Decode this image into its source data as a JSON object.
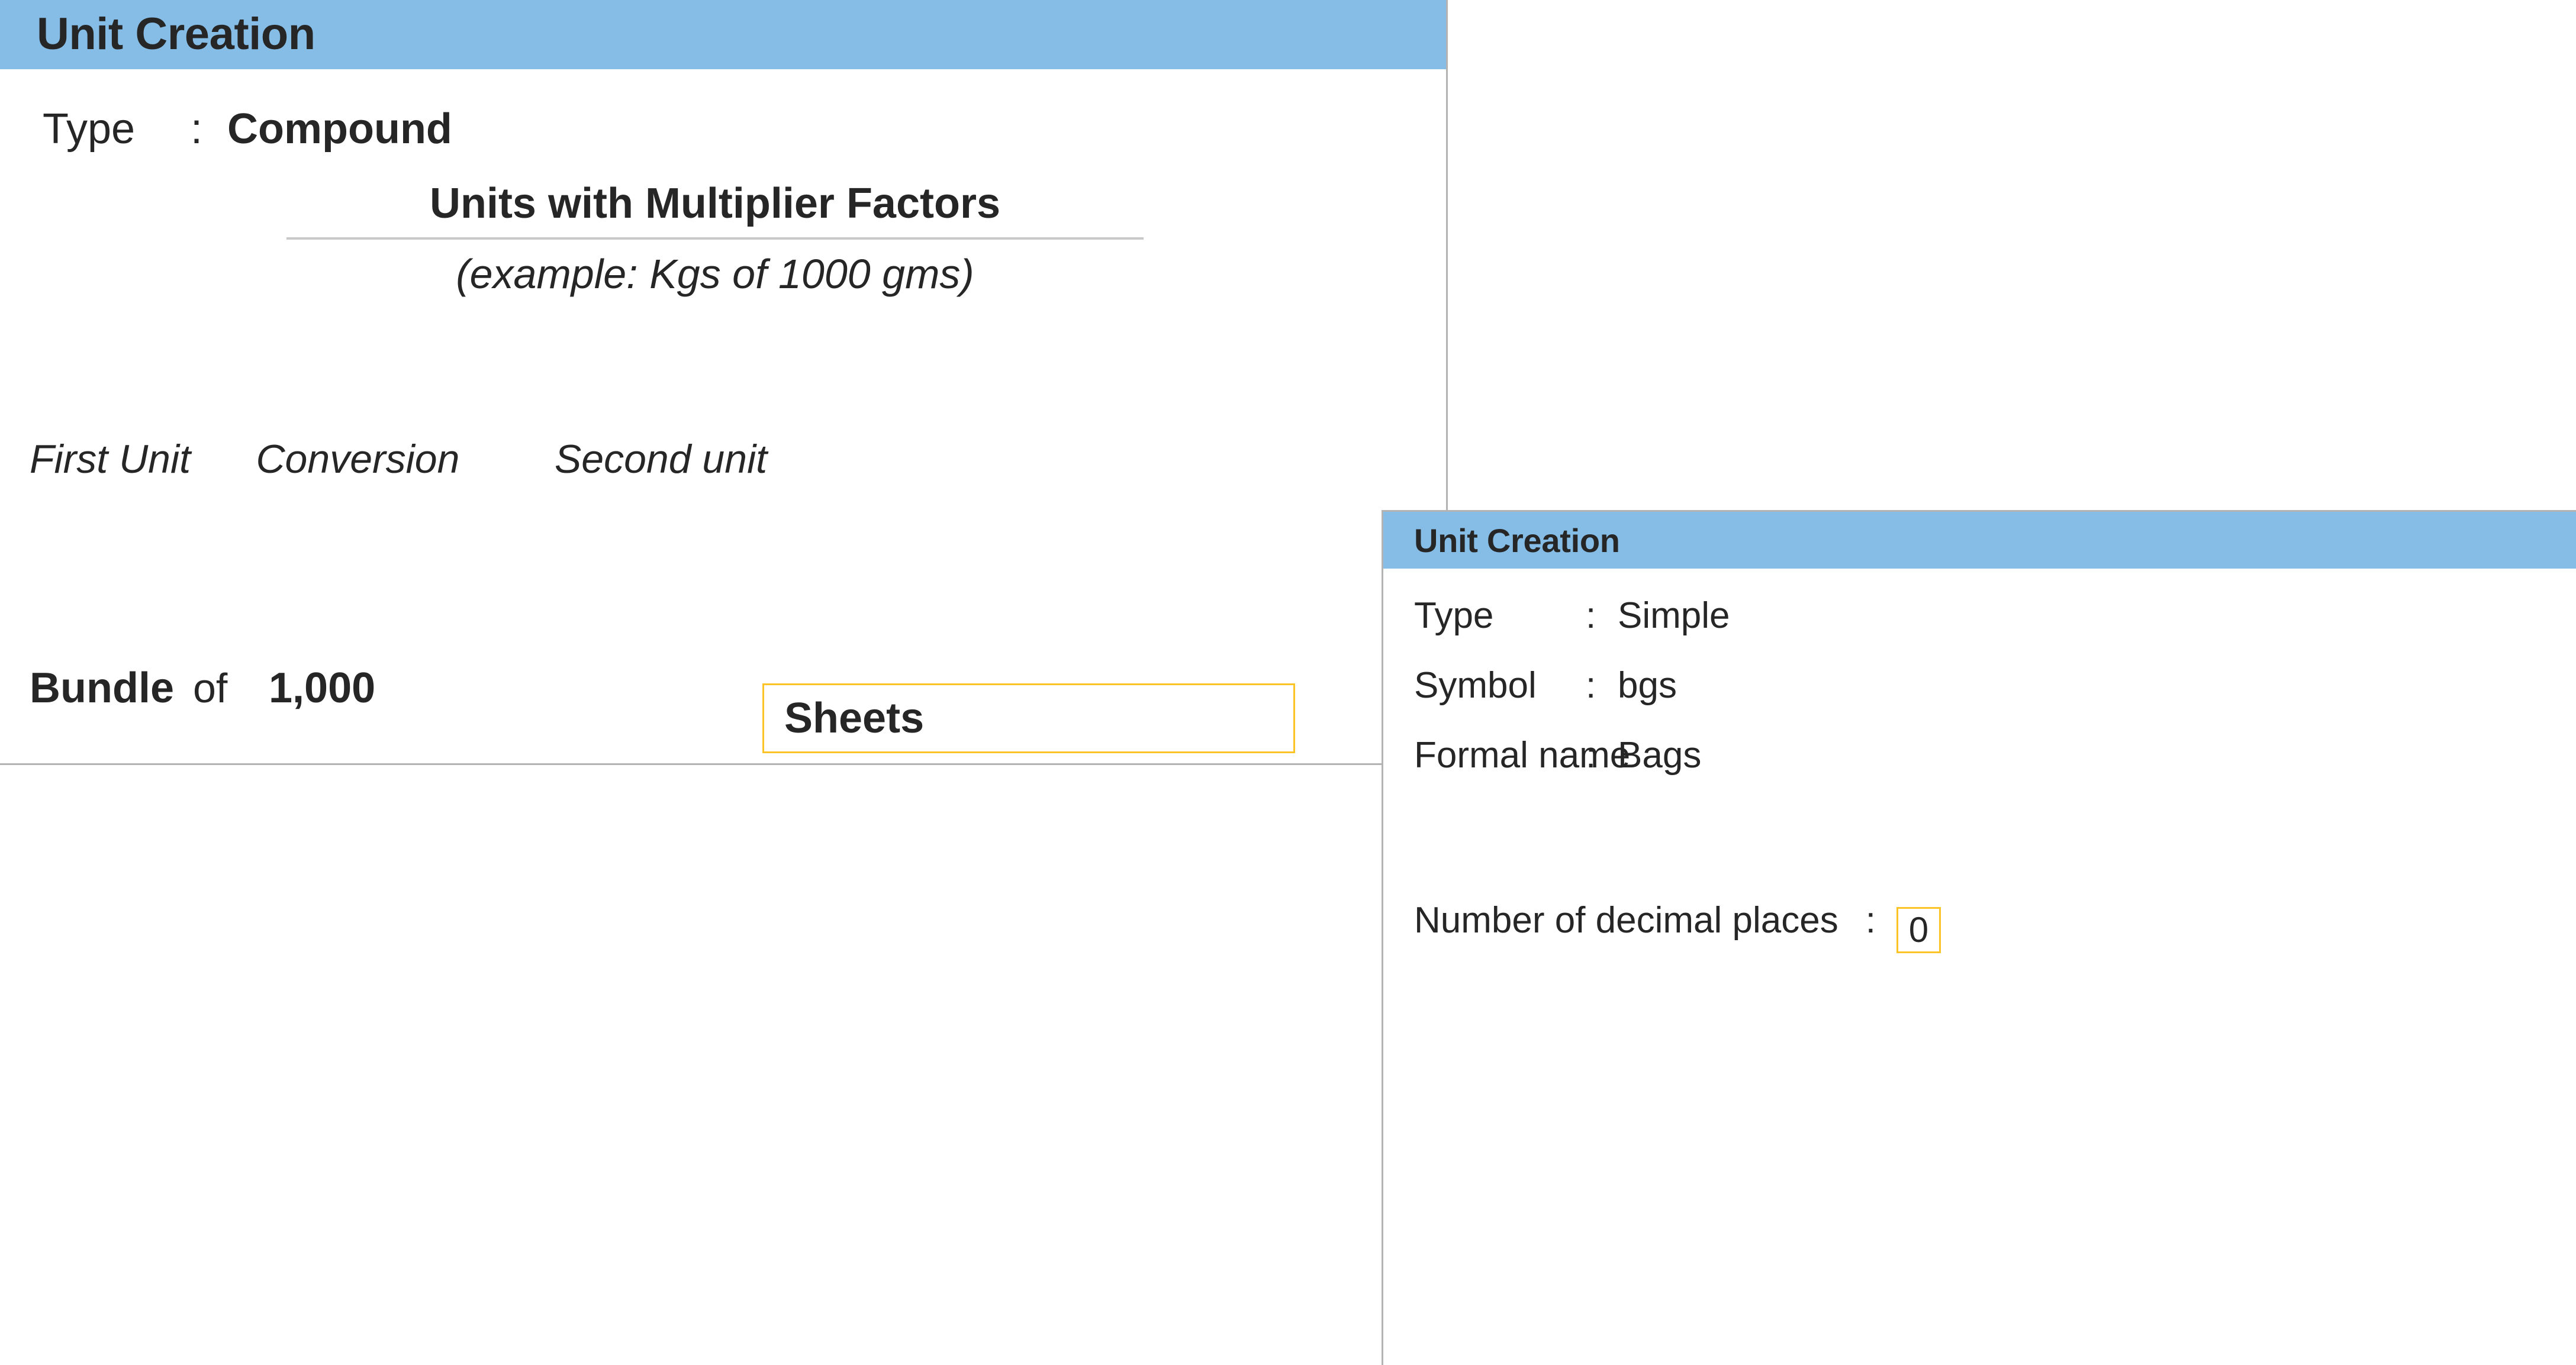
{
  "compound_dialog": {
    "title": "Unit Creation",
    "type_row": {
      "label": "Type",
      "colon": ":",
      "value": "Compound"
    },
    "section": {
      "heading": "Units with Multiplier Factors",
      "example": "(example: Kgs of 1000 gms)"
    },
    "column_headers": {
      "first_unit": "First Unit",
      "conversion": "Conversion",
      "second_unit": "Second unit"
    },
    "data_row": {
      "first_unit": "Bundle",
      "of": "of",
      "quantity": "1,000",
      "second_unit_value": "Sheets"
    }
  },
  "simple_dialog": {
    "title": "Unit Creation",
    "rows": [
      {
        "label": "Type",
        "colon": ":",
        "value": "Simple"
      },
      {
        "label": "Symbol",
        "colon": ":",
        "value": "bgs"
      },
      {
        "label": "Formal name",
        "colon": ":",
        "value": "Bags"
      }
    ],
    "decimals_row": {
      "label": "Number of decimal places",
      "colon": ":",
      "value": "0"
    }
  },
  "colors": {
    "titlebar_blue": "#85bde7",
    "field_border_gold": "#fdc428",
    "panel_border_gray": "#b3b3b3",
    "rule_gray": "#c9c9c9",
    "text_dark": "#262626"
  }
}
